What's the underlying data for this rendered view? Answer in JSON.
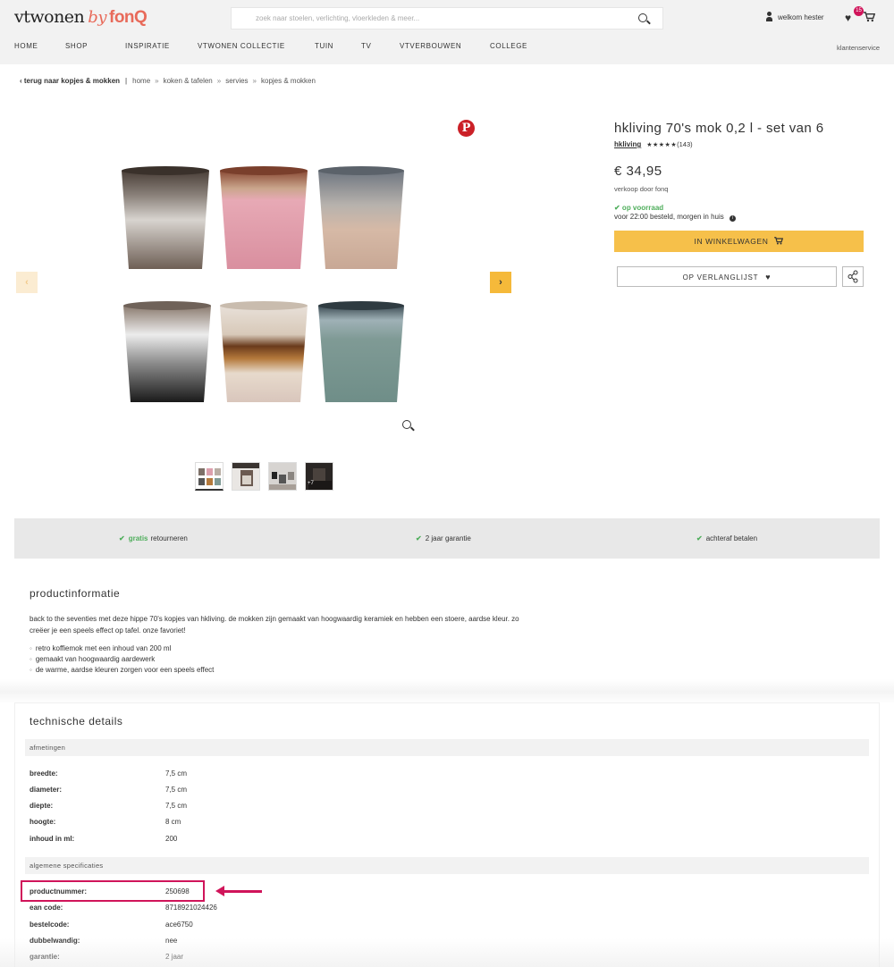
{
  "header": {
    "logo_main": "vtwonen",
    "logo_by": "by",
    "logo_fonq": "fonQ",
    "search_placeholder": "zoek naar stoelen, verlichting, vloerkleden & meer...",
    "user_label": "welkom hester",
    "wishlist_count": "15",
    "nav": [
      "HOME",
      "SHOP",
      "INSPIRATIE",
      "VTWONEN COLLECTIE",
      "TUIN",
      "TV",
      "VTVERBOUWEN",
      "COLLEGE"
    ],
    "service_label": "klantenservice"
  },
  "breadcrumb": {
    "back": "terug naar kopjes & mokken",
    "items": [
      "home",
      "koken & tafelen",
      "servies",
      "kopjes & mokken"
    ]
  },
  "gallery": {
    "pin_glyph": "P",
    "prev": "‹",
    "next": "›",
    "thumb_more": "+7"
  },
  "product": {
    "title": "hkliving 70's mok 0,2 l - set van 6",
    "brand": "hkliving",
    "stars": "★★★★★",
    "reviews": "(143)",
    "price": "€ 34,95",
    "seller": "verkoop door fonq",
    "stock": "✔ op voorraad",
    "delivery": "voor 22:00 besteld, morgen in huis",
    "add_to_cart": "IN WINKELWAGEN",
    "wishlist": "OP VERLANGLIJST"
  },
  "usps": [
    {
      "highlight": "gratis",
      "text": "retourneren"
    },
    {
      "highlight": "",
      "text": "2 jaar garantie"
    },
    {
      "highlight": "",
      "text": "achteraf betalen"
    }
  ],
  "productinfo": {
    "heading": "productinformatie",
    "description": "back to the seventies met deze hippe 70's kopjes van hkliving. de mokken zijn gemaakt van hoogwaardig keramiek en hebben een stoere, aardse kleur. zo creëer je een speels effect op tafel. onze favoriet!",
    "bullets": [
      "retro koffiemok met een inhoud van 200 ml",
      "gemaakt van hoogwaardig aardewerk",
      "de warme, aardse kleuren zorgen voor een speels effect"
    ]
  },
  "technical": {
    "heading": "technische details",
    "dimensions_heading": "afmetingen",
    "dimensions": [
      {
        "label": "breedte:",
        "value": "7,5 cm"
      },
      {
        "label": "diameter:",
        "value": "7,5 cm"
      },
      {
        "label": "diepte:",
        "value": "7,5 cm"
      },
      {
        "label": "hoogte:",
        "value": "8 cm"
      },
      {
        "label": "inhoud in ml:",
        "value": "200"
      }
    ],
    "general_heading": "algemene specificaties",
    "general": [
      {
        "label": "productnummer:",
        "value": "250698"
      },
      {
        "label": "ean code:",
        "value": "8718921024426"
      },
      {
        "label": "bestelcode:",
        "value": "ace6750"
      },
      {
        "label": "dubbelwandig:",
        "value": "nee"
      },
      {
        "label": "garantie:",
        "value": "2 jaar"
      }
    ]
  },
  "colors": {
    "accent": "#e86a5a",
    "button_yellow": "#f6c04a",
    "stock_green": "#4fae5c",
    "highlight_red": "#d0145a",
    "pinterest_red": "#cb2027"
  },
  "icons": [
    "search-icon",
    "user-icon",
    "heart-icon",
    "cart-icon",
    "pinterest-icon",
    "zoom-icon",
    "share-icon",
    "info-icon",
    "check-icon"
  ]
}
